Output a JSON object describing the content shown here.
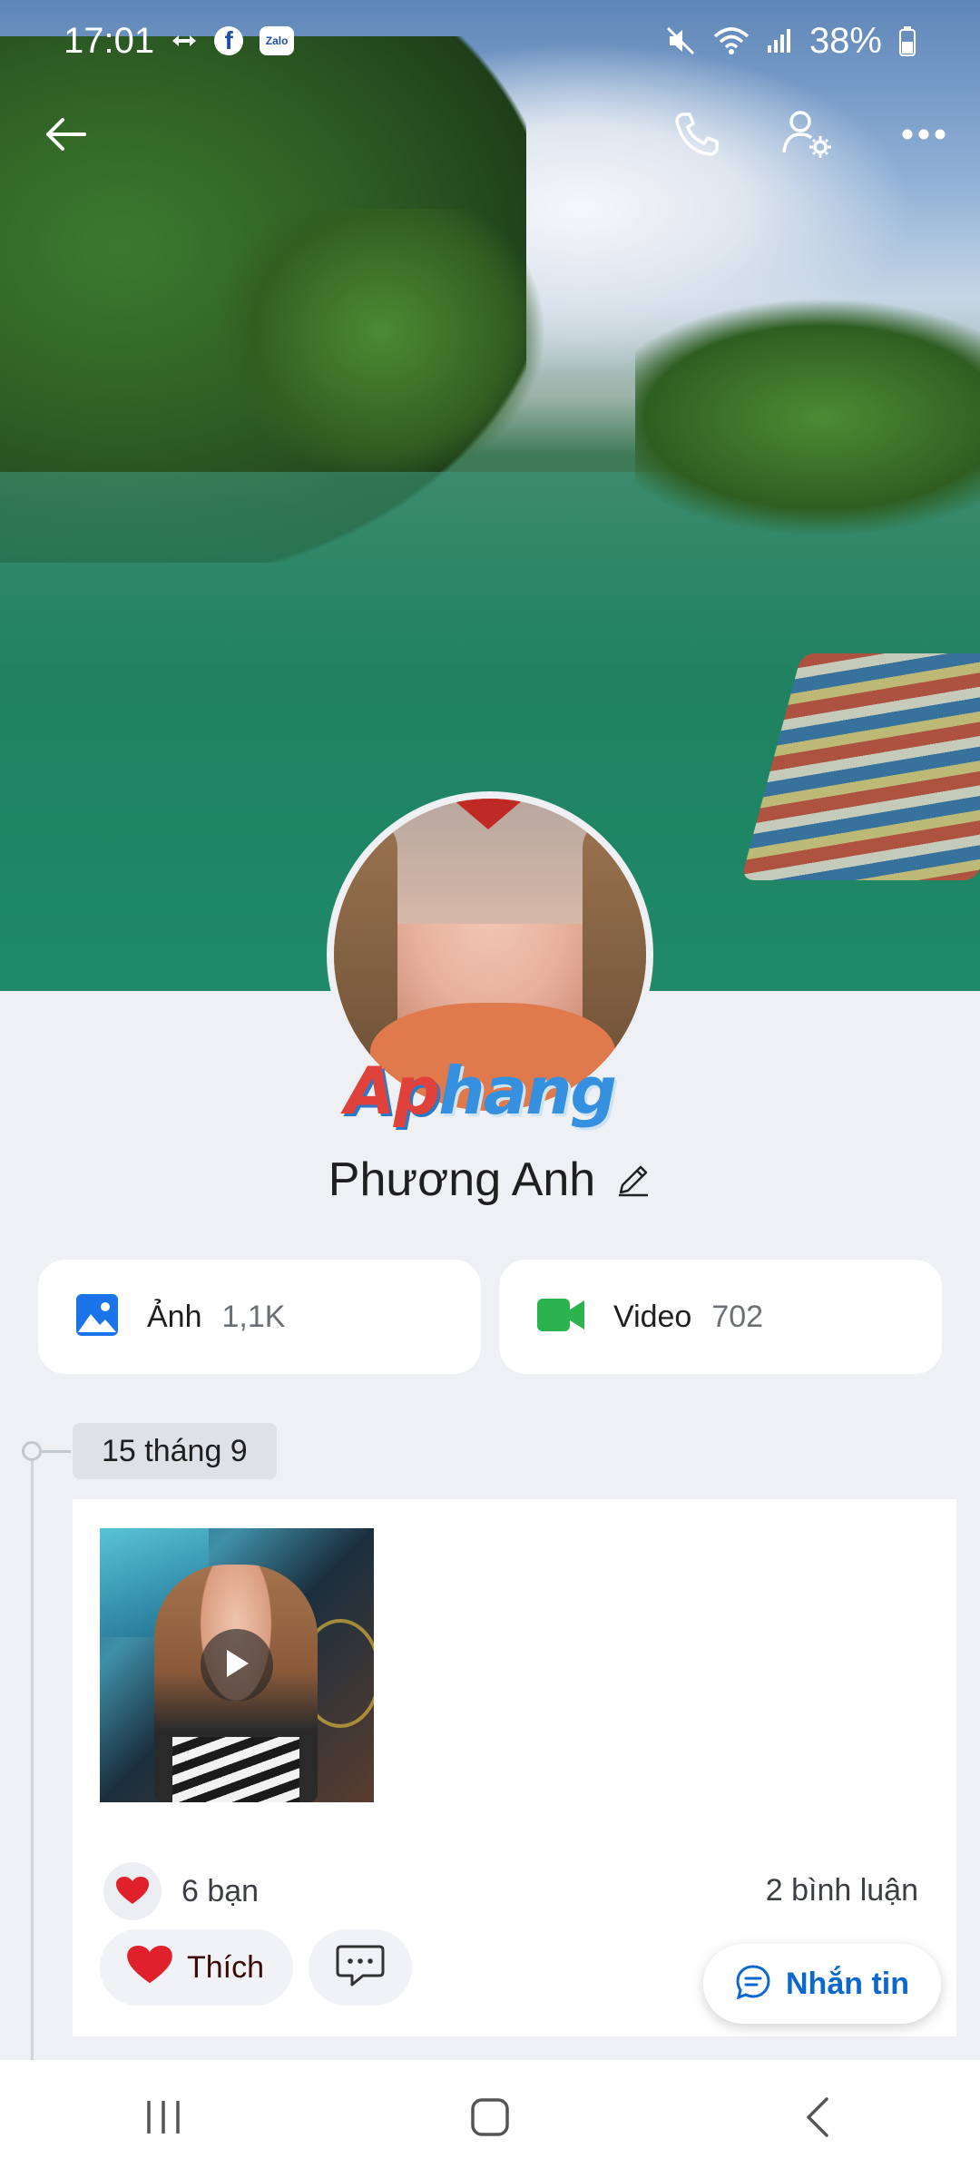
{
  "status_bar": {
    "time": "17:01",
    "battery": "38%",
    "icons": [
      "sync-arrows-icon",
      "facebook-icon",
      "zalo-icon",
      "mute-icon",
      "wifi-icon",
      "signal-icon",
      "battery-icon"
    ],
    "zalo_label": "Zalo",
    "facebook_label": "f"
  },
  "header": {
    "icons": [
      "back-arrow-icon",
      "phone-icon",
      "profile-settings-icon",
      "more-icon"
    ]
  },
  "profile": {
    "name": "Phương Anh",
    "watermark_left": "Ap",
    "watermark_right": "hang"
  },
  "media": {
    "photos_label": "Ảnh",
    "photos_count": "1,1K",
    "videos_label": "Video",
    "videos_count": "702"
  },
  "timeline": {
    "date": "15 tháng 9",
    "post": {
      "reactions": "6 bạn",
      "comments": "2 bình luận",
      "like_label": "Thích"
    }
  },
  "message_button": {
    "label": "Nhắn tin"
  },
  "colors": {
    "accent_blue": "#0a68d0",
    "heart_red": "#e0202b",
    "video_green": "#2bb34d",
    "photo_blue": "#1a73e8"
  }
}
